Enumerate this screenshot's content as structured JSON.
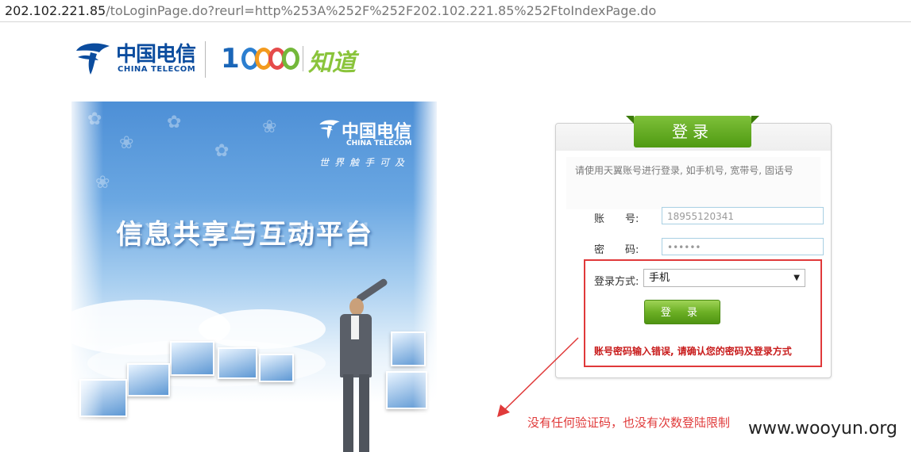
{
  "browser": {
    "url_host": "202.102.221.85",
    "url_path": "/toLoginPage.do?reurl=http%253A%252F%252F202.102.221.85%252FtoIndexPage.do"
  },
  "header": {
    "logo_cn": "中国电信",
    "logo_en": "CHINA TELECOM",
    "logo_10000": "10000",
    "logo_zhidao": "知道"
  },
  "banner": {
    "brand_cn": "中国电信",
    "brand_en": "CHINA TELECOM",
    "slogan": "世界触手可及",
    "headline": "信息共享与互动平台"
  },
  "login": {
    "title": "登录",
    "hint": "请使用天翼账号进行登录, 如手机号, 宽带号, 固话号",
    "account_label": "账　　号:",
    "account_value": "18955120341",
    "password_label": "密　　码:",
    "password_value": "••••••",
    "method_label": "登录方式:",
    "method_value": "手机",
    "submit_label": "登 录",
    "error": "账号密码输入错误, 请确认您的密码及登录方式"
  },
  "annotation": {
    "note": "没有任何验证码，也没有次数登陆限制",
    "watermark": "www.wooyun.org",
    "accent_color": "#e03a3a"
  }
}
